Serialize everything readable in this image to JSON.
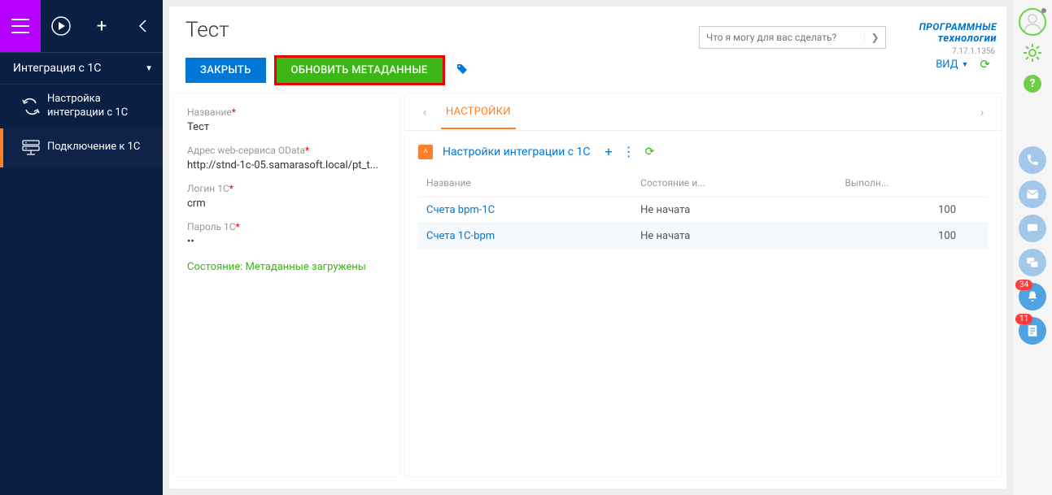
{
  "topbar": {},
  "sidebar": {
    "header": "Интеграция с 1С",
    "items": [
      {
        "label": "Настройка интеграции с 1С"
      },
      {
        "label": "Подключение к 1С"
      }
    ]
  },
  "page": {
    "title": "Тест",
    "search_placeholder": "Что я могу для вас сделать?",
    "logo_line1": "ПРОГРАММНЫЕ",
    "logo_line2": "технологии",
    "version": "7.17.1.1356"
  },
  "actions": {
    "close": "ЗАКРЫТЬ",
    "update_meta": "ОБНОВИТЬ МЕТАДАННЫЕ",
    "view": "ВИД"
  },
  "form": {
    "name_label": "Название",
    "name_value": "Тест",
    "odata_label": "Адрес web-сервиса OData",
    "odata_value": "http://stnd-1c-05.samarasoft.local/pt_t...",
    "login_label": "Логин 1С",
    "login_value": "crm",
    "password_label": "Пароль 1С",
    "password_value": "••",
    "status": "Состояние: Метаданные загружены"
  },
  "tabs": {
    "settings": "НАСТРОЙКИ"
  },
  "detail": {
    "section_title": "Настройки интеграции с 1С",
    "columns": {
      "name": "Название",
      "state": "Состояние и...",
      "done": "Выполн..."
    },
    "rows": [
      {
        "name": "Счета bpm-1C",
        "state": "Не начата",
        "done": "100"
      },
      {
        "name": "Счета 1C-bpm",
        "state": "Не начата",
        "done": "100"
      }
    ]
  },
  "rightbar": {
    "badge_bell": "34",
    "badge_note": "11"
  }
}
